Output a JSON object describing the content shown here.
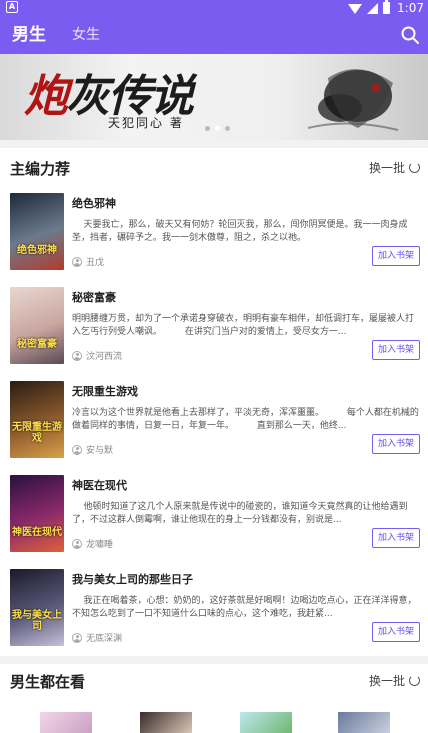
{
  "status_bar": {
    "time": "1:07",
    "notification": "A"
  },
  "app_bar": {
    "tabs": [
      {
        "label": "男生",
        "active": true
      },
      {
        "label": "女生",
        "active": false
      }
    ]
  },
  "banner": {
    "title_red": "炮",
    "title_rest": "灰传说",
    "author_line": "天犯同心   著",
    "page_count": 3,
    "active_page": 1
  },
  "recommend": {
    "title": "主编力荐",
    "refresh_label": "换一批",
    "books": [
      {
        "title": "绝色邪神",
        "cover_text": "绝色邪神",
        "desc": "    天要我亡，那么，破天又有何妨？轮回灭我，那么，闯你阴冥便是。我一一肉身成圣，挡者，碾碎予之。我一一剑木傲尊，阻之，杀之以祂。",
        "author": "丑戊",
        "add_label": "加入书架",
        "cover_colors": [
          "#1d2a3a",
          "#6b7a8c",
          "#b33b2a"
        ]
      },
      {
        "title": "秘密富豪",
        "cover_text": "秘密富豪",
        "desc": "明明腰缠万贯，却为了一个承诺身穿破衣，明明有豪车相伴，却低调打车，屡屡被人打入乞丐行列受人嘲讽。        在讲究门当户对的爱情上，受尽女方一...",
        "author": "汶河西流",
        "add_label": "加入书架",
        "cover_colors": [
          "#e8d8d0",
          "#caa6a0",
          "#5a4a55"
        ]
      },
      {
        "title": "无限重生游戏",
        "cover_text": "无限重生游戏",
        "desc": "冷言以为这个世界就是他看上去那样了，平淡无奇，浑浑噩噩。        每个人都在机械的做着同样的事情，日复一日，年复一年。        直到那么一天，他终...",
        "author": "安与默",
        "add_label": "加入书架",
        "cover_colors": [
          "#2a1c14",
          "#8c5a2c",
          "#d9a04a"
        ]
      },
      {
        "title": "神医在现代",
        "cover_text": "神医在现代",
        "desc": "    他顿时知道了这几个人原来就是传说中的碰瓷的，谁知道今天竟然真的让他给遇到了，不过这群人倒霉啊，谁让他现在的身上一分钱都没有，别说是...",
        "author": "龙嘯睡",
        "add_label": "加入书架",
        "cover_colors": [
          "#2a1040",
          "#8a2a6a",
          "#e0603a"
        ]
      },
      {
        "title": "我与美女上司的那些日子",
        "cover_text": "我与美女上司",
        "desc": "    我正在喝着茶，心想：奶奶的，这好茶就是好喝啊！边喝边吃点心，正在洋洋得意，不知怎么吃到了一口不知道什么口味的点心，这个难吃，我赶紧...",
        "author": "无底深渊",
        "add_label": "加入书架",
        "cover_colors": [
          "#1a1a2a",
          "#5a5a7a",
          "#c8c0d8"
        ]
      }
    ]
  },
  "also_reading": {
    "title": "男生都在看",
    "refresh_label": "换一批"
  },
  "colors": {
    "accent": "#7B5CF0",
    "button_text": "#6a4ce6"
  },
  "icons": {
    "search": "search-icon",
    "refresh": "refresh-icon",
    "author": "person-icon"
  }
}
